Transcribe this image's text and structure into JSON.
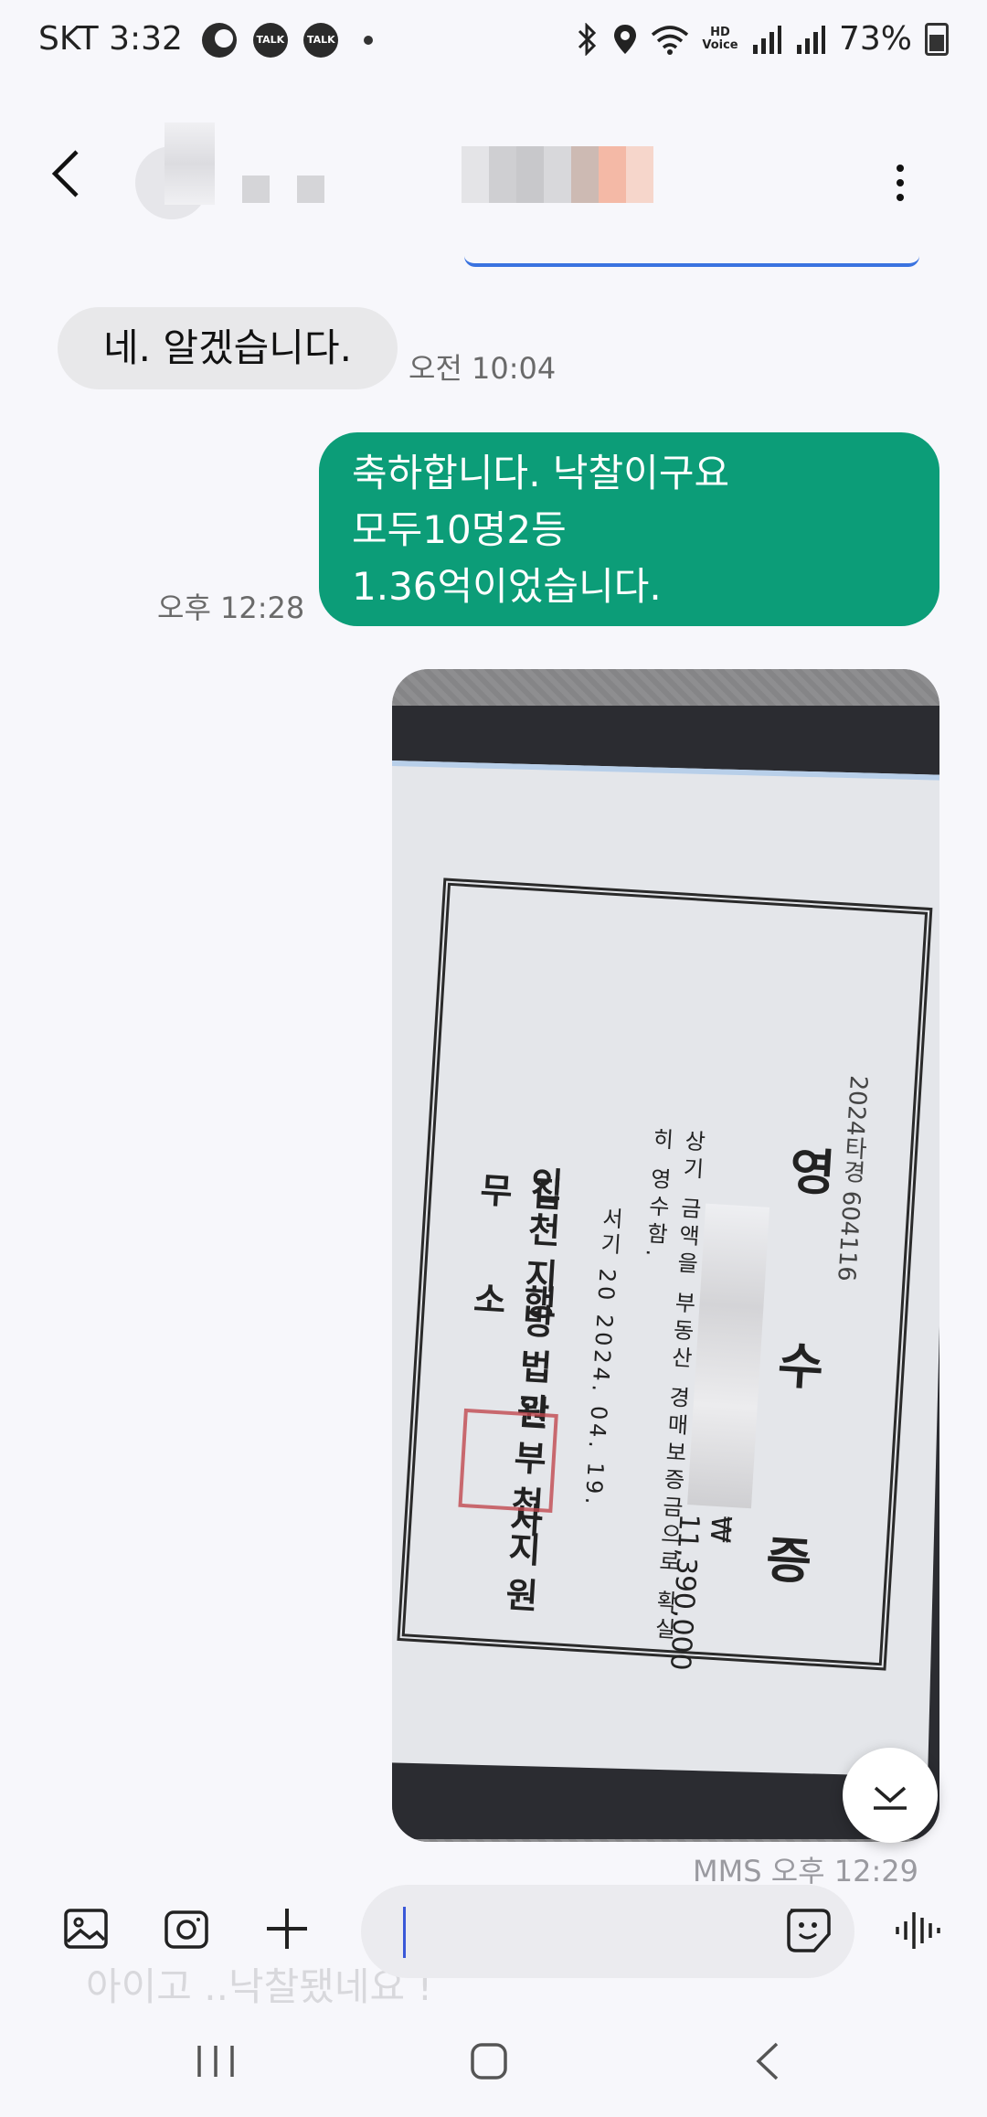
{
  "status_bar": {
    "carrier_time": "SKT 3:32",
    "talk_badge": "TALK",
    "hd_voice": "HD Voice",
    "battery": "73%"
  },
  "header": {
    "back_icon": "chevron-left-icon",
    "more_icon": "more-vertical-icon"
  },
  "messages": [
    {
      "direction": "incoming",
      "text": "네. 알겠습니다.",
      "time": "오전 10:04"
    },
    {
      "direction": "outgoing",
      "lines": [
        "축하합니다. 낙찰이구요",
        "모두10명2등",
        "1.36억이었습니다."
      ],
      "time": "오후 12:28"
    },
    {
      "direction": "outgoing",
      "type": "image",
      "time": "MMS 오후 12:29"
    }
  ],
  "receipt_photo": {
    "title": "영 수 증",
    "subtitle": "2024타경 604116",
    "body": "상기 금액을 부동산 경매보증금으로 확실히 영수함.",
    "date": "서기 20 2024. 04. 19.",
    "court": "인천지방법원부천지원",
    "office": "집 행 관 사 무 소",
    "amount": "₩ 11,390,000"
  },
  "composer": {
    "draft_peek": "아이고 ..낙찰됐네요 !",
    "icons": [
      "gallery-icon",
      "camera-icon",
      "plus-icon",
      "emoji-sticker-icon",
      "voice-input-icon"
    ]
  },
  "nav_bar": {
    "icons": [
      "recent-apps-icon",
      "home-icon",
      "back-nav-icon"
    ]
  },
  "colors": {
    "outgoing_bubble": "#0c9d78",
    "incoming_bubble": "#e8e8ea",
    "background": "#f7f7fb"
  }
}
